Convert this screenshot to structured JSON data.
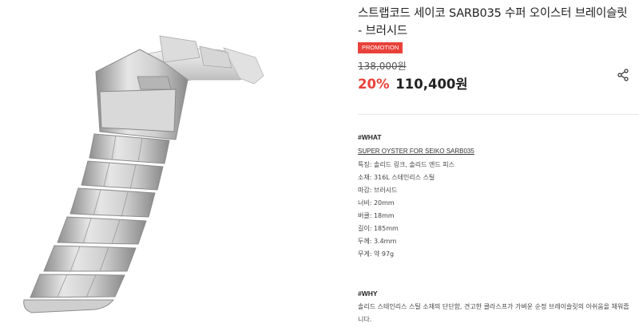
{
  "product": {
    "title": "스트랩코드 세이코 SARB035 수퍼 오이스터 브레이슬릿 - 브러시드",
    "promo_badge": "PROMOTION",
    "original_price": "138,000원",
    "discount": "20%",
    "sale_price": "110,400원",
    "image_alt": "bracelet-photo"
  },
  "what": {
    "heading": "#WHAT",
    "link": "SUPER OYSTER FOR SEIKO SARB035",
    "specs": [
      "특징: 솔리드 링크, 솔리드 엔드 피스",
      "소재: 316L 스테인리스 스틸",
      "마감: 브러시드",
      "너비: 20mm",
      "버클: 18mm",
      "길이: 185mm",
      "두께: 3.4mm",
      "무게: 약 97g"
    ]
  },
  "why": {
    "heading": "#WHY",
    "text": "솔리드 스테인리스 스틸 소재의 단단함, 견고한 클라스프가 가벼운 순정 브레이슬릿의 아쉬움을 채워줍니다."
  },
  "colors": {
    "accent": "#e8413a",
    "steel_light": "#e9e9e9",
    "steel_dark": "#9a9a9a"
  }
}
